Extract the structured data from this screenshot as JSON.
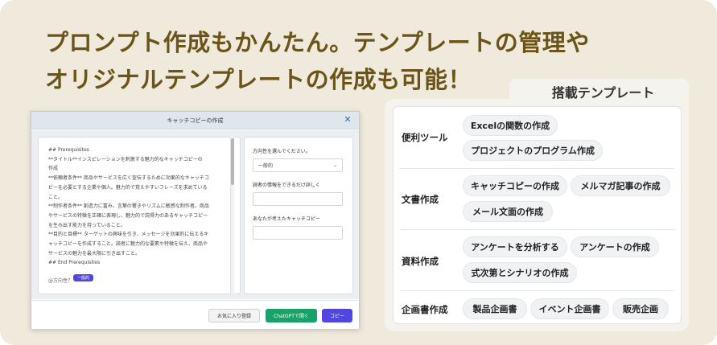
{
  "headline": {
    "line1": "プロンプト作成もかんたん。テンプレートの管理や",
    "line2": "オリジナルテンプレートの作成も可能！"
  },
  "modal": {
    "title": "キャッチコピーの作成",
    "prompt_lines": [
      "## Prerequisites",
      "**タイトル**インスピレーションを刺激する魅力的なキャッチコピーの",
      "作成",
      "**依頼者条件** 商品やサービスを広く宣伝するために効果的なキャッチコ",
      "ピーを必要とする企業や個人。魅力的で覚えやすいフレーズを求めている",
      "こと。",
      "**制作者条件** 創造力に富み、言葉の響きやリズムに敏感な制作者。商品",
      "やサービスの特徴を正確に表現し、魅力的で説得力のあるキャッチコピー",
      "を生み出す能力を持っていること。",
      "**目的と目標** ターゲットの興味を引き、メッセージを効果的に伝えるキ",
      "ャッチコピーを作成すること。読者に魅力的な要素や特徴を伝え、商品や",
      "サービスの魅力を最大限に引き出すこと。",
      "## End Prerequisites"
    ],
    "var_text": "@方向性？",
    "var_pill": "一般的",
    "form": {
      "direction_label": "方向性を選んでください。",
      "direction_value": "一般的",
      "reader_label": "読者の情報をできるだけ詳しく",
      "catch_label": "あなたが考えたキャッチコピー"
    },
    "buttons": {
      "favorite": "お気に入り登録",
      "chatgpt": "ChatGPTで開く",
      "copy": "コピー"
    }
  },
  "templates": {
    "tab_title": "搭載テンプレート",
    "categories": [
      {
        "name": "便利ツール",
        "items": [
          "Excelの関数の作成",
          "プロジェクトのプログラム作成"
        ]
      },
      {
        "name": "文書作成",
        "items": [
          "キャッチコピーの作成",
          "メルマガ記事の作成",
          "メール文面の作成"
        ]
      },
      {
        "name": "資料作成",
        "items": [
          "アンケートを分析する",
          "アンケートの作成",
          "式次第とシナリオの作成"
        ]
      },
      {
        "name": "企画書作成",
        "items": [
          "製品企画書",
          "イベント企画書",
          "販売企画"
        ]
      }
    ]
  }
}
